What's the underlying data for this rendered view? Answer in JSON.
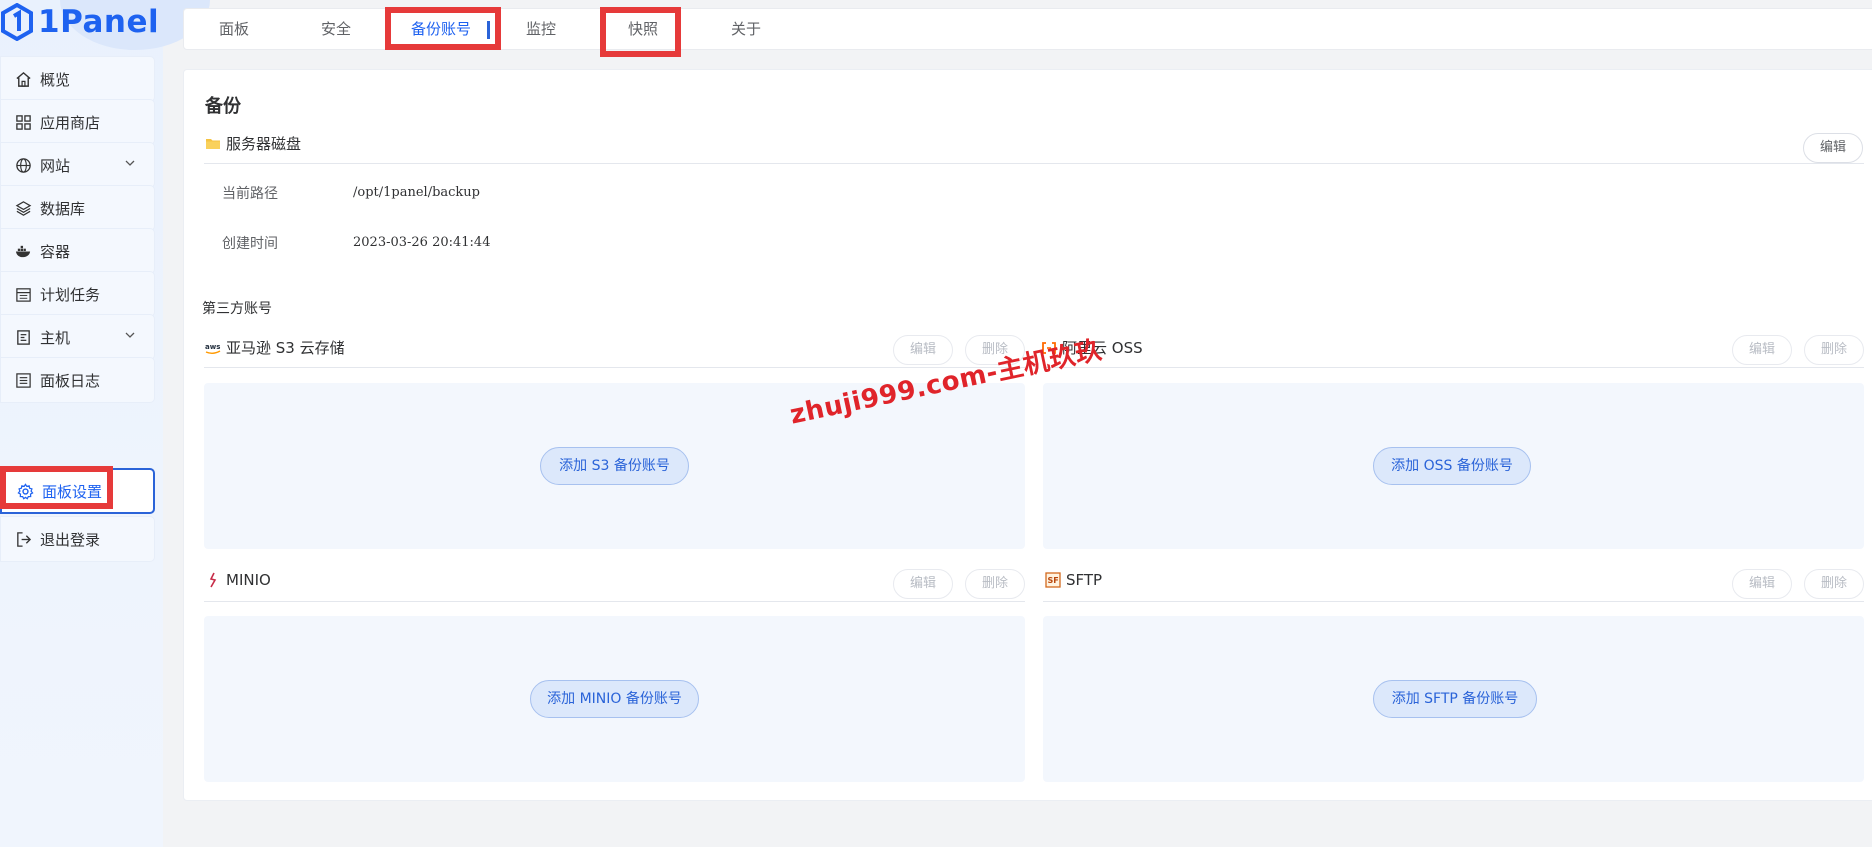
{
  "app": {
    "logo_text": "1Panel"
  },
  "sidebar": {
    "items": [
      {
        "label": "概览",
        "icon": "home-icon"
      },
      {
        "label": "应用商店",
        "icon": "grid-icon"
      },
      {
        "label": "网站",
        "icon": "globe-icon",
        "expandable": true
      },
      {
        "label": "数据库",
        "icon": "layers-icon"
      },
      {
        "label": "容器",
        "icon": "docker-icon"
      },
      {
        "label": "计划任务",
        "icon": "calendar-icon"
      },
      {
        "label": "主机",
        "icon": "host-icon",
        "expandable": true
      },
      {
        "label": "面板日志",
        "icon": "log-icon"
      },
      {
        "label": "面板设置",
        "icon": "gear-icon",
        "active": true
      },
      {
        "label": "退出登录",
        "icon": "logout-icon"
      }
    ]
  },
  "tabs": [
    {
      "label": "面板"
    },
    {
      "label": "安全"
    },
    {
      "label": "备份账号",
      "active": true
    },
    {
      "label": "监控"
    },
    {
      "label": "快照"
    },
    {
      "label": "关于"
    }
  ],
  "backup": {
    "title": "备份",
    "server_disk": {
      "label": "服务器磁盘",
      "edit": "编辑",
      "path_label": "当前路径",
      "path_value": "/opt/1panel/backup",
      "time_label": "创建时间",
      "time_value": "2023-03-26 20:41:44"
    },
    "third_party_title": "第三方账号",
    "accounts": [
      {
        "name": "亚马逊 S3 云存储",
        "icon": "aws-icon",
        "edit": "编辑",
        "delete": "删除",
        "add": "添加 S3 备份账号"
      },
      {
        "name": "阿里云 OSS",
        "icon": "aliyun-icon",
        "edit": "编辑",
        "delete": "删除",
        "add": "添加 OSS 备份账号"
      },
      {
        "name": "MINIO",
        "icon": "minio-icon",
        "edit": "编辑",
        "delete": "删除",
        "add": "添加 MINIO 备份账号"
      },
      {
        "name": "SFTP",
        "icon": "sftp-icon",
        "edit": "编辑",
        "delete": "删除",
        "add": "添加 SFTP 备份账号"
      }
    ]
  },
  "watermark": "zhuji999.com-主机玖玖",
  "colors": {
    "accent": "#1e62f0",
    "highlight": "#e63a3a",
    "watermark": "#e0242a"
  }
}
